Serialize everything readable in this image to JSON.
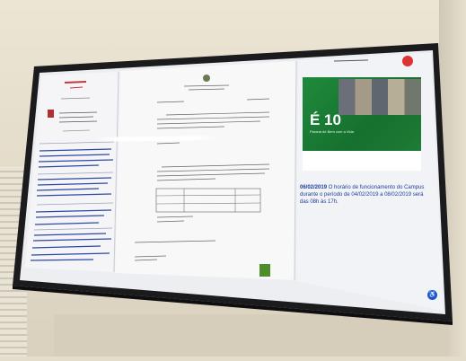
{
  "scene": {
    "description_shown": "",
    "tv_screen": {
      "left_column": {
        "org_name": "CORSJF",
        "org_sub": "Secretaria",
        "sections": [
          "Informações",
          "Acessibilidade",
          "Notícias"
        ]
      },
      "banner": {
        "headline": "É 10",
        "subline": "Paraná de Bem com a Vida"
      },
      "news": {
        "date": "06/02/2019",
        "text": "O horário de funcionamento do Campus durante o período de 04/02/2019 a 08/02/2019 será das 08h às 17h."
      }
    }
  }
}
